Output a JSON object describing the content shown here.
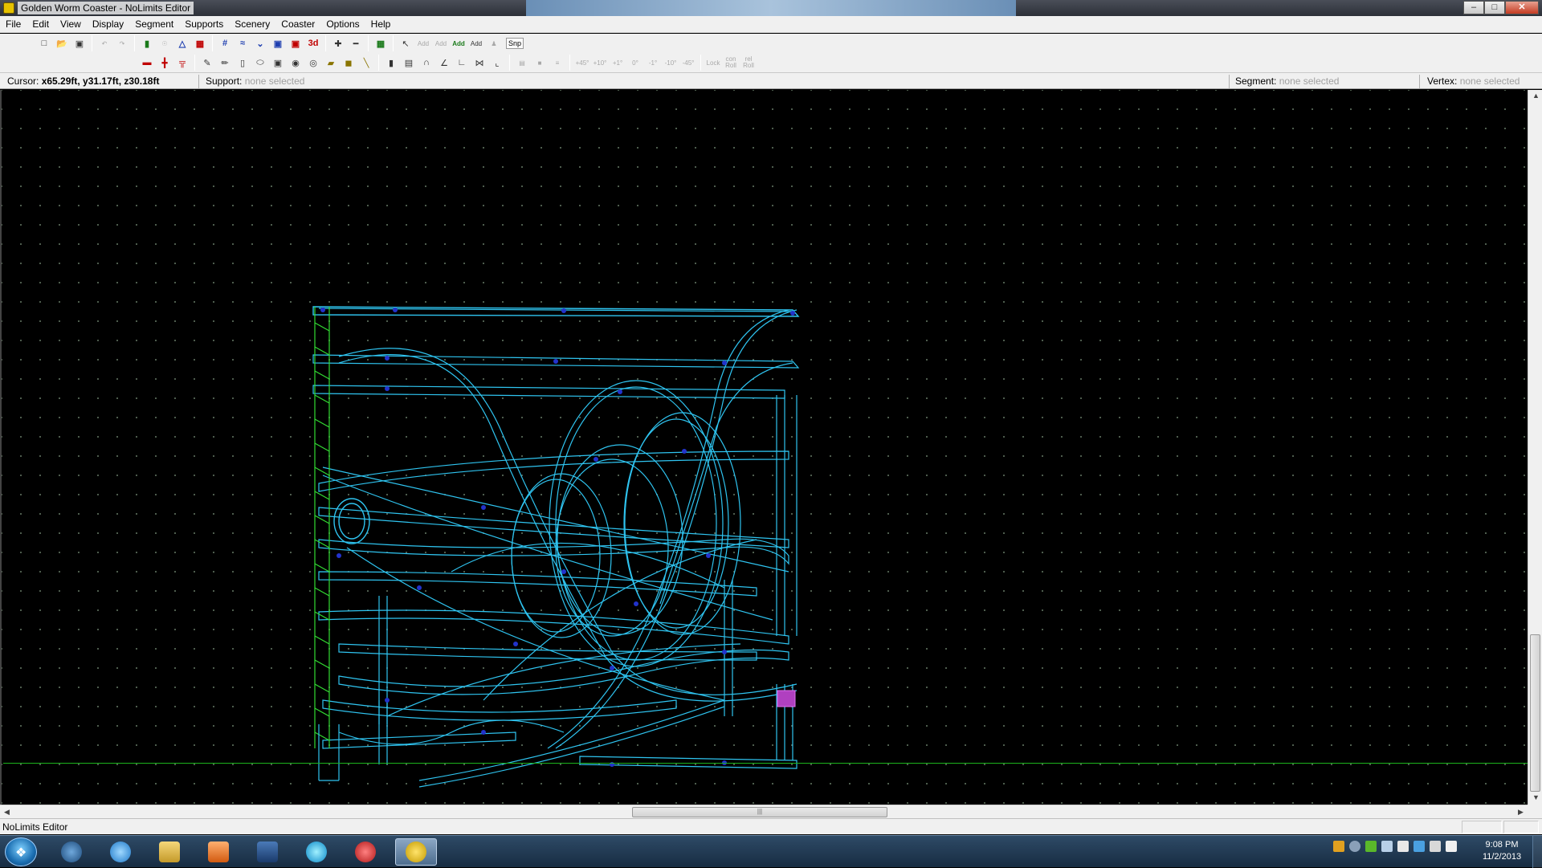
{
  "window": {
    "title": "Golden Worm Coaster - NoLimits Editor",
    "minimize": "–",
    "maximize": "□",
    "close": "✕"
  },
  "menu": [
    "File",
    "Edit",
    "View",
    "Display",
    "Segment",
    "Supports",
    "Scenery",
    "Coaster",
    "Options",
    "Help"
  ],
  "toolbar1": {
    "add_labels": [
      "Add",
      "Add",
      "Add",
      "Add"
    ],
    "three_d_label": "3d",
    "snap_label": "Snp"
  },
  "toolbar2": {
    "bank_labels": [
      "+45°",
      "+10°",
      "+1°",
      "0°",
      "-1°",
      "-10°",
      "-45°"
    ],
    "lock_label": "Lock",
    "con_roll_label": "con Roll",
    "rel_roll_label": "rel Roll"
  },
  "infobar": {
    "cursor_label": "Cursor:",
    "cursor_value": "x65.29ft, y31.17ft, z30.18ft",
    "support_label": "Support:",
    "support_value": "none selected",
    "segment_label": "Segment:",
    "segment_value": "none selected",
    "vertex_label": "Vertex:",
    "vertex_value": "none selected"
  },
  "colors": {
    "track": "#2fc4f0",
    "track_dark": "#1e8fc0",
    "vertex": "#2233cc",
    "support_green": "#33dd33",
    "ground": "#1db31d",
    "station": "#b040c0"
  },
  "status": {
    "text": "NoLimits Editor"
  },
  "taskbar": {
    "clock_time": "9:08 PM",
    "clock_date": "11/2/2013",
    "apps": [
      "hp-icon",
      "internet-explorer-icon",
      "file-explorer-icon",
      "media-player-icon",
      "tasks-icon",
      "browser-orb-icon",
      "record-icon",
      "nolimits-editor-icon"
    ]
  }
}
